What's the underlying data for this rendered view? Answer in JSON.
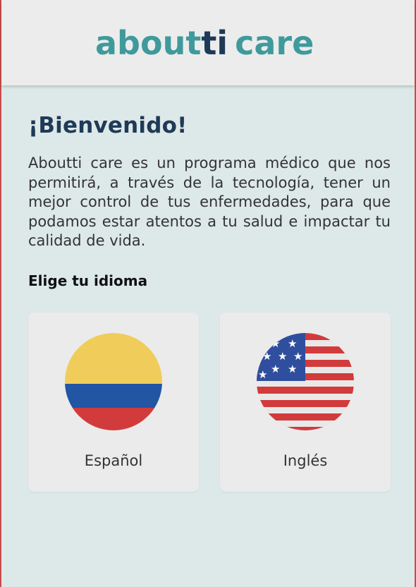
{
  "brand": {
    "logo_text_prefix": "about",
    "logo_text_mid": "ti",
    "logo_text_suffix": "care",
    "logo_color": "#3f9a9b",
    "logo_accent_color": "#1f3a57"
  },
  "welcome": {
    "title": "¡Bienvenido!",
    "description": "Aboutti care es un programa médico que nos permitirá, a través de la tecnología, tener un mejor control de tus enfermedades, para que podamos estar atentos a tu salud e impactar tu calidad de vida."
  },
  "language": {
    "heading": "Elige tu idioma",
    "options": [
      {
        "label": "Español",
        "flag_icon": "colombia-flag-icon"
      },
      {
        "label": "Inglés",
        "flag_icon": "usa-flag-icon"
      }
    ]
  },
  "colors": {
    "background": "#dde8e9",
    "header": "#ececec",
    "card": "#ebebeb",
    "title": "#1f3a57"
  }
}
